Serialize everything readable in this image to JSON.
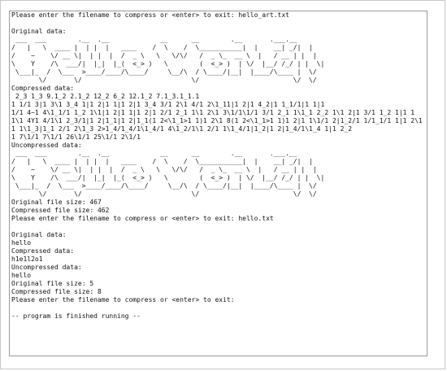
{
  "console": {
    "lines": [
      "Please enter the filename to compress or <enter> to exit: hello_art.txt",
      "",
      "Original data:",
      " ___  ___        .__  .__             __      __        .__       .___.__",
      "/   |   \\  ____ |  | |  |   ____    /  \\    /  \\___________|  |    __| _/|  |",
      "/    ~    \\/ __ \\|  | |  |  /  _ \\   \\   \\/\\/   /  _ \\_  __ \\  |   / __ | |  |",
      "\\    Y    /\\  ___/|  |_|  |_(  <_> )   \\        (  <_> )  | \\/  |__/ /_/ | |  \\|",
      " \\___|_  /  \\___  >____/____/\\____/     \\__/\\  / \\____/|__|  |____/\\____ |  \\/",
      "       \\/       \\/                            \\/                        \\/  \\/",
      "Compressed data:",
      " 2_3 1_3 9.1_2 2.1_2 12_2 6_2 12.1_2 7.1_3.1_1.1",
      "1 1/1 3|1 3\\1 3_4 1|1 2|1 1|1 2|1 3_4 3/1 2\\1 4/1 2\\1_11|1 2|1 4_2|1 1_1/1|1 1|1",
      "1/1 4~1 4\\1_1/1 1_2 1\\1|1 2|1 1|1 2|1 2/1 2_1 1\\1 2\\1 3\\1/1\\1/1 3/1 2_1 1\\1_1 2_2 1\\1 2|1 3/1 1_2 1|1 1",
      "1\\1 4Y1 4/1\\1 2_3/1|1 2|1_1|1 2|1_1(1 2<\\1_1>1 1)1 2\\1 8(1 2<\\1_1>1 1)1 2|1 1\\1/1 2|1_2/1 1/1_1/1 1|1 2\\1",
      "1 1\\1_3|1_1 2/1 2\\1_3 2>1_4/1_4/1\\1_4/1 4\\1_2/1\\1 2/1 1\\1_4/1|1_2|1 2|1_4/1\\1_4 1|1 2_2",
      "1 7\\1/1 7\\1/1 26\\1/1 25\\1/1 2\\1/1",
      "Uncompressed data:",
      " ___  ___        .__  .__             __      __        .__       .___.__",
      "/   |   \\  ____ |  | |  |   ____    /  \\    /  \\___________|  |    __| _/|  |",
      "/    ~    \\/ __ \\|  | |  |  /  _ \\   \\   \\/\\/   /  _ \\_  __ \\  |   / __ | |  |",
      "\\    Y    /\\  ___/|  |_|  |_(  <_> )   \\        (  <_> )  | \\/  |__/ /_/ | |  \\|",
      " \\___|_  /  \\___  >____/____/\\____/     \\__/\\  / \\____/|__|  |____/\\____ |  \\/",
      "       \\/       \\/                            \\/                        \\/  \\/",
      "Original file size: 467",
      "Compressed file size: 462",
      "Please enter the filename to compress or <enter> to exit: hello.txt",
      "",
      "Original data:",
      "hello",
      "Compressed data:",
      "h1e1l2o1",
      "Uncompressed data:",
      "hello",
      "Original file size: 5",
      "Compressed file size: 8",
      "Please enter the filename to compress or <enter> to exit:",
      "",
      "-- program is finished running --"
    ]
  }
}
